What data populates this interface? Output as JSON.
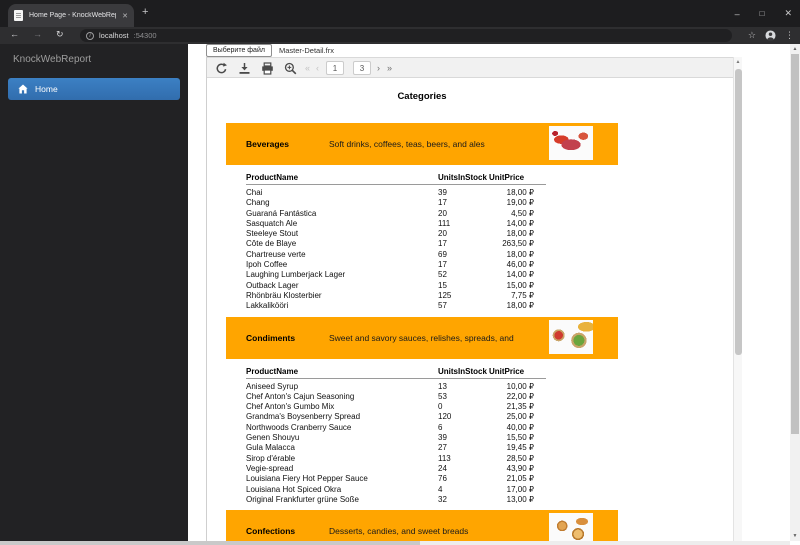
{
  "browser": {
    "tab": {
      "title": "Home Page - KnockWebReport",
      "close_glyph": "✕"
    },
    "new_tab_glyph": "+",
    "window": {
      "minimize_glyph": "–",
      "maximize_glyph": "□",
      "close_glyph": "✕"
    },
    "nav": {
      "back_glyph": "←",
      "forward_glyph": "→",
      "reload_glyph": "↻"
    },
    "address": {
      "info_glyph": "i",
      "host": "localhost",
      "port": ":54300"
    },
    "bookmark_glyph": "☆",
    "menu_glyph": "⋮"
  },
  "sidebar": {
    "brand": "KnockWebReport",
    "items": [
      {
        "label": "Home",
        "icon": "home-icon",
        "active": true
      }
    ]
  },
  "viewer": {
    "file_button_label": "Выберите файл",
    "file_name": "Master-Detail.frx",
    "toolbar_icons": [
      "refresh-icon",
      "save-icon",
      "print-icon",
      "zoom-icon"
    ],
    "pager": {
      "first_glyph": "«",
      "prev_glyph": "‹",
      "current_page": "1",
      "total_pages": "3",
      "next_glyph": "›",
      "last_glyph": "»"
    }
  },
  "report": {
    "title": "Categories",
    "columns": {
      "name": "ProductName",
      "units": "UnitsInStock",
      "price": "UnitPrice"
    },
    "sections": [
      {
        "name": "Beverages",
        "description": "Soft drinks, coffees, teas, beers, and ales",
        "image": "beverages-photo",
        "rows": [
          [
            "Chai",
            "39",
            "18,00 ₽"
          ],
          [
            "Chang",
            "17",
            "19,00 ₽"
          ],
          [
            "Guaraná Fantástica",
            "20",
            "4,50 ₽"
          ],
          [
            "Sasquatch Ale",
            "111",
            "14,00 ₽"
          ],
          [
            "Steeleye Stout",
            "20",
            "18,00 ₽"
          ],
          [
            "Côte de Blaye",
            "17",
            "263,50 ₽"
          ],
          [
            "Chartreuse verte",
            "69",
            "18,00 ₽"
          ],
          [
            "Ipoh Coffee",
            "17",
            "46,00 ₽"
          ],
          [
            "Laughing Lumberjack Lager",
            "52",
            "14,00 ₽"
          ],
          [
            "Outback Lager",
            "15",
            "15,00 ₽"
          ],
          [
            "Rhönbräu Klosterbier",
            "125",
            "7,75 ₽"
          ],
          [
            "Lakkalikööri",
            "57",
            "18,00 ₽"
          ]
        ]
      },
      {
        "name": "Condiments",
        "description": "Sweet and savory sauces, relishes, spreads, and",
        "image": "condiments-photo",
        "rows": [
          [
            "Aniseed Syrup",
            "13",
            "10,00 ₽"
          ],
          [
            "Chef Anton's Cajun Seasoning",
            "53",
            "22,00 ₽"
          ],
          [
            "Chef Anton's Gumbo Mix",
            "0",
            "21,35 ₽"
          ],
          [
            "Grandma's Boysenberry Spread",
            "120",
            "25,00 ₽"
          ],
          [
            "Northwoods Cranberry Sauce",
            "6",
            "40,00 ₽"
          ],
          [
            "Genen Shouyu",
            "39",
            "15,50 ₽"
          ],
          [
            "Gula Malacca",
            "27",
            "19,45 ₽"
          ],
          [
            "Sirop d'érable",
            "113",
            "28,50 ₽"
          ],
          [
            "Vegie-spread",
            "24",
            "43,90 ₽"
          ],
          [
            "Louisiana Fiery Hot Pepper Sauce",
            "76",
            "21,05 ₽"
          ],
          [
            "Louisiana Hot Spiced Okra",
            "4",
            "17,00 ₽"
          ],
          [
            "Original Frankfurter grüne Soße",
            "32",
            "13,00 ₽"
          ]
        ]
      },
      {
        "name": "Confections",
        "description": "Desserts, candies, and sweet breads",
        "image": "confections-photo",
        "rows": []
      }
    ]
  },
  "colors": {
    "banner_orange": "#FFA500",
    "active_item_blue": "#337AB7",
    "chrome_dark": "#1D1D1F"
  }
}
